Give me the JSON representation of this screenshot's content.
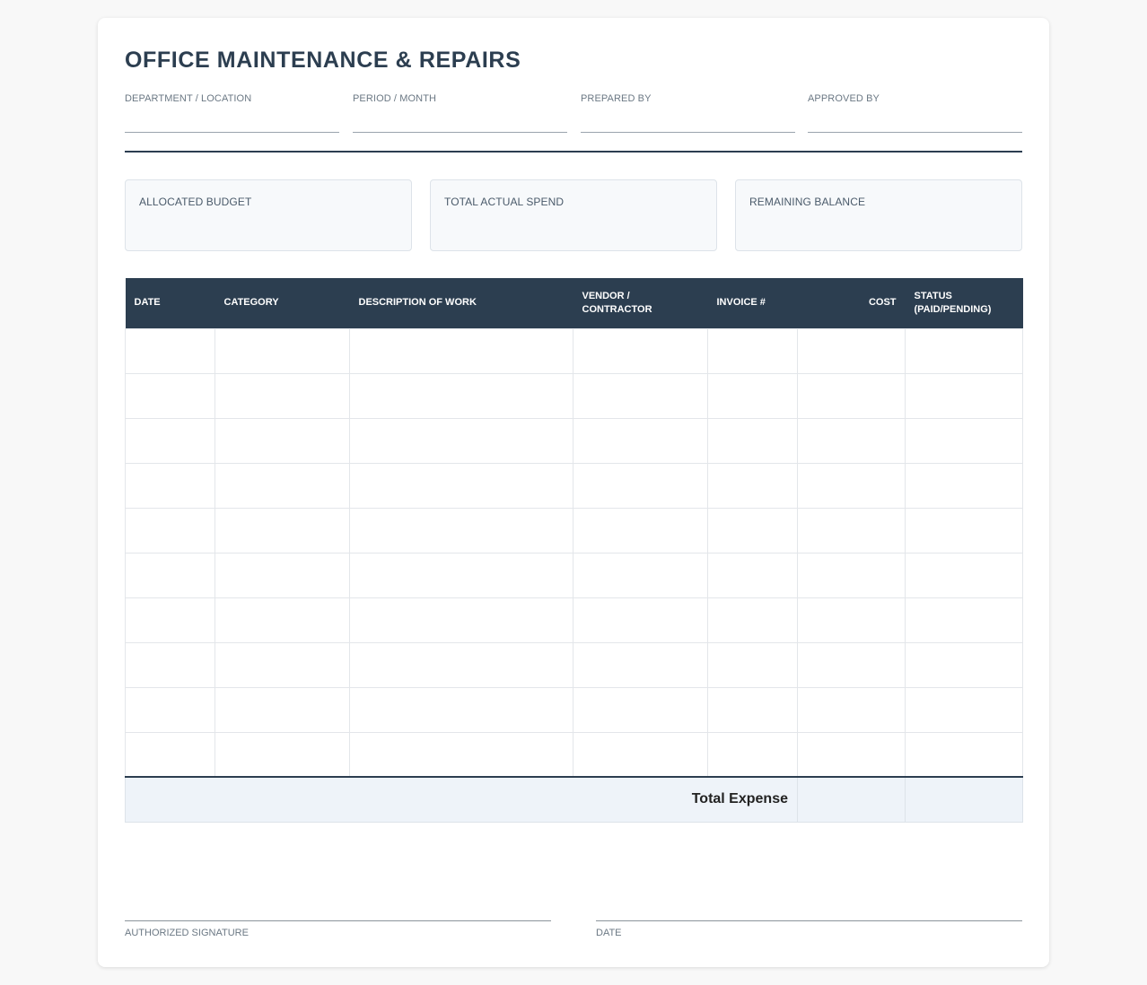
{
  "form": {
    "title": "OFFICE MAINTENANCE & REPAIRS"
  },
  "meta_fields": [
    {
      "label": "DEPARTMENT / LOCATION",
      "value": ""
    },
    {
      "label": "PERIOD / MONTH",
      "value": ""
    },
    {
      "label": "PREPARED BY",
      "value": ""
    },
    {
      "label": "APPROVED BY",
      "value": ""
    }
  ],
  "summary": [
    {
      "label": "ALLOCATED BUDGET",
      "value": ""
    },
    {
      "label": "TOTAL ACTUAL SPEND",
      "value": ""
    },
    {
      "label": "REMAINING BALANCE",
      "value": ""
    }
  ],
  "table": {
    "headers": [
      "DATE",
      "CATEGORY",
      "DESCRIPTION OF WORK",
      "VENDOR / CONTRACTOR",
      "INVOICE #",
      "COST",
      "STATUS (PAID/PENDING)"
    ],
    "rows": [
      [
        "",
        "",
        "",
        "",
        "",
        "",
        ""
      ],
      [
        "",
        "",
        "",
        "",
        "",
        "",
        ""
      ],
      [
        "",
        "",
        "",
        "",
        "",
        "",
        ""
      ],
      [
        "",
        "",
        "",
        "",
        "",
        "",
        ""
      ],
      [
        "",
        "",
        "",
        "",
        "",
        "",
        ""
      ],
      [
        "",
        "",
        "",
        "",
        "",
        "",
        ""
      ],
      [
        "",
        "",
        "",
        "",
        "",
        "",
        ""
      ],
      [
        "",
        "",
        "",
        "",
        "",
        "",
        ""
      ],
      [
        "",
        "",
        "",
        "",
        "",
        "",
        ""
      ],
      [
        "",
        "",
        "",
        "",
        "",
        "",
        ""
      ]
    ],
    "total_label": "Total Expense",
    "total_cost": "",
    "total_status": ""
  },
  "signatures": {
    "authorized_label": "AUTHORIZED SIGNATURE",
    "date_label": "DATE"
  },
  "colors": {
    "header_bg": "#2c3e50",
    "total_row_bg": "#eef3f9",
    "card_bg": "#f7f9fb"
  }
}
